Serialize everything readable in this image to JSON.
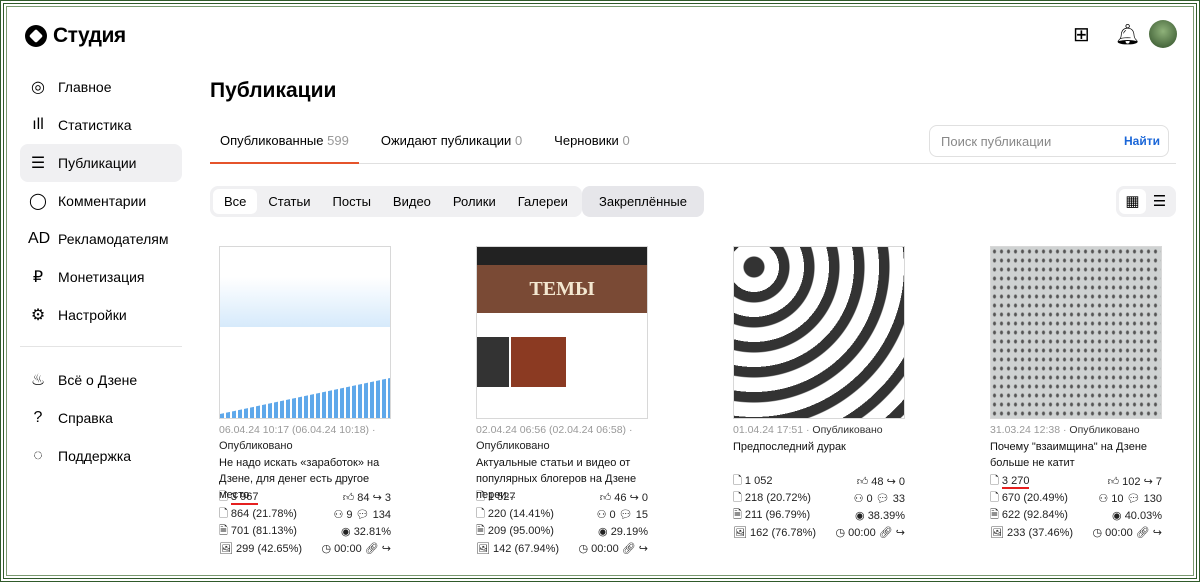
{
  "app": {
    "title": "Студия"
  },
  "sidebar": {
    "items": [
      {
        "label": "Главное",
        "icon": "◎"
      },
      {
        "label": "Статистика",
        "icon": "ıll"
      },
      {
        "label": "Публикации",
        "icon": "☰",
        "active": true
      },
      {
        "label": "Комментарии",
        "icon": "◯"
      },
      {
        "label": "Рекламодателям",
        "icon": "AD"
      },
      {
        "label": "Монетизация",
        "icon": "₽"
      },
      {
        "label": "Настройки",
        "icon": "⚙"
      }
    ],
    "items2": [
      {
        "label": "Всё о Дзене",
        "icon": "♨"
      },
      {
        "label": "Справка",
        "icon": "?"
      },
      {
        "label": "Поддержка",
        "icon": "◌"
      }
    ]
  },
  "page": {
    "title": "Публикации"
  },
  "tabs": [
    {
      "label": "Опубликованные",
      "count": "599"
    },
    {
      "label": "Ожидают публикации",
      "count": "0"
    },
    {
      "label": "Черновики",
      "count": "0"
    }
  ],
  "search": {
    "placeholder": "Поиск публикации",
    "button": "Найти"
  },
  "filters": [
    "Все",
    "Статьи",
    "Посты",
    "Видео",
    "Ролики",
    "Галереи"
  ],
  "pinned": "Закреплённые",
  "cards": [
    {
      "date": "06.04.24 10:17 (06.04.24 10:18) ·",
      "status": "Опубликовано",
      "title": "Не надо искать «заработок» на Дзене, для денег есть другое место",
      "views": "3 967",
      "reads": "864 (21.78%)",
      "full": "701 (81.13%)",
      "subs": "299 (42.65%)",
      "likes": "84",
      "reposts": "3",
      "followers": "9",
      "comments": "134",
      "ctr": "32.81%",
      "time": "00:00"
    },
    {
      "date": "02.04.24 06:56 (02.04.24 06:58) ·",
      "status": "Опубликовано",
      "title": "Актуальные статьи и видео от популярных блогеров на Дзене переи...",
      "views": "1 527",
      "reads": "220 (14.41%)",
      "full": "209 (95.00%)",
      "subs": "142 (67.94%)",
      "likes": "46",
      "reposts": "0",
      "followers": "0",
      "comments": "15",
      "ctr": "29.19%",
      "time": "00:00"
    },
    {
      "date": "01.04.24 17:51 ·",
      "status": "Опубликовано",
      "title": "Предпоследний дурак",
      "views": "1 052",
      "reads": "218 (20.72%)",
      "full": "211 (96.79%)",
      "subs": "162 (76.78%)",
      "likes": "48",
      "reposts": "0",
      "followers": "0",
      "comments": "33",
      "ctr": "38.39%",
      "time": "00:00"
    },
    {
      "date": "31.03.24 12:38 ·",
      "status": "Опубликовано",
      "title": "Почему \"взаимщина\" на Дзене больше не катит",
      "views": "3 270",
      "reads": "670 (20.49%)",
      "full": "622 (92.84%)",
      "subs": "233 (37.46%)",
      "likes": "102",
      "reposts": "7",
      "followers": "10",
      "comments": "130",
      "ctr": "40.03%",
      "time": "00:00"
    }
  ],
  "thumb2_text": "ТЕМЫ"
}
